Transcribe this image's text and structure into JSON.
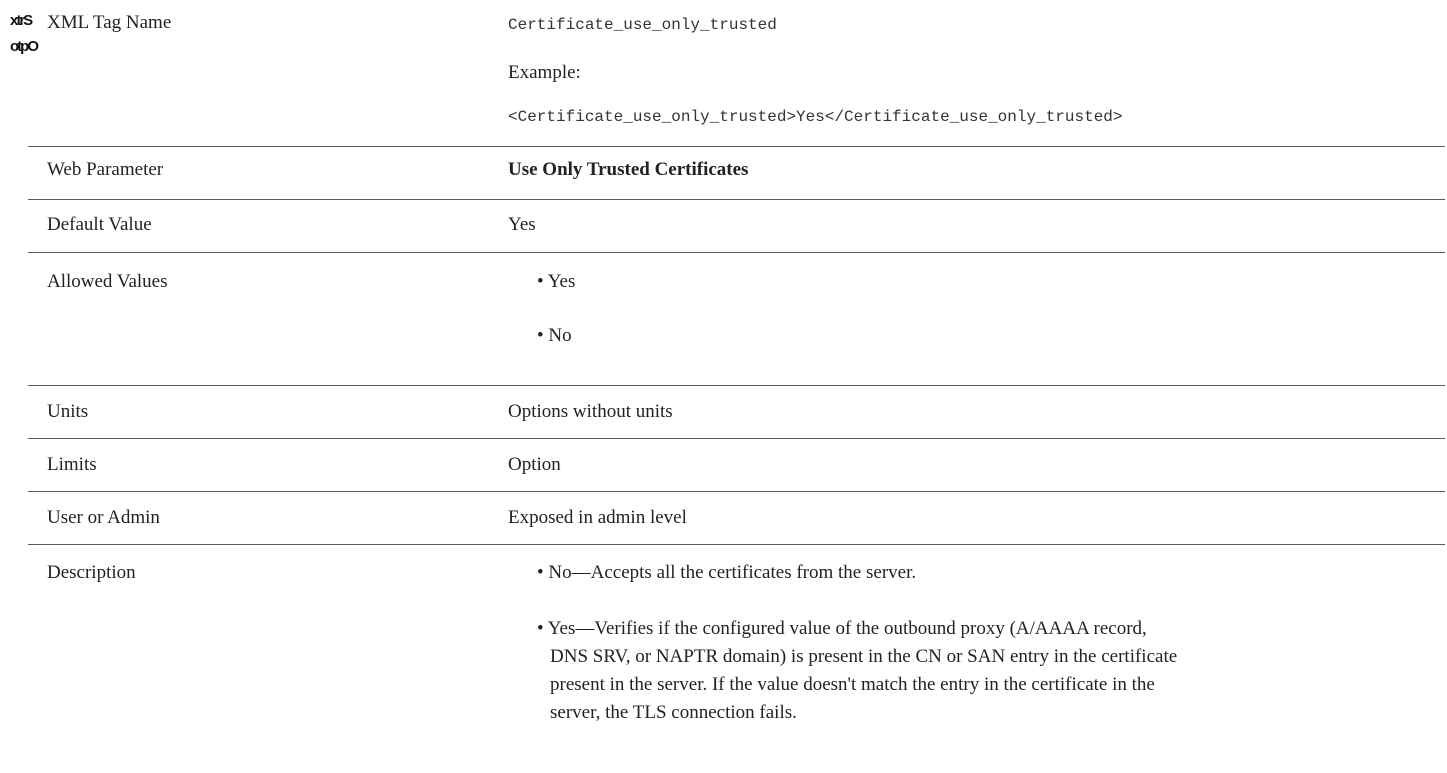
{
  "overlap_glyphs": {
    "line1": "xtrS",
    "line2": "otpO"
  },
  "rows": {
    "xml_tag": {
      "label": "XML Tag Name",
      "value": "Certificate_use_only_trusted",
      "example_label": "Example:",
      "example": "<Certificate_use_only_trusted>Yes</Certificate_use_only_trusted>"
    },
    "web_parameter": {
      "label": "Web Parameter",
      "value": "Use Only Trusted Certificates"
    },
    "default_value": {
      "label": "Default Value",
      "value": "Yes"
    },
    "allowed_values": {
      "label": "Allowed Values",
      "items": [
        "• Yes",
        "• No"
      ]
    },
    "units": {
      "label": "Units",
      "value": "Options without units"
    },
    "limits": {
      "label": "Limits",
      "value": "Option"
    },
    "user_or_admin": {
      "label": "User or Admin",
      "value": "Exposed in admin level"
    },
    "description": {
      "label": "Description",
      "items": [
        "• No—Accepts all the certificates from the server.",
        "• Yes—Verifies if the configured value of the outbound proxy (A/AAAA record,",
        "DNS SRV, or NAPTR domain) is present in the CN or SAN entry in the certificate",
        "present in the server. If the value doesn't match the entry in the certificate in the",
        "server, the TLS connection fails."
      ]
    }
  }
}
